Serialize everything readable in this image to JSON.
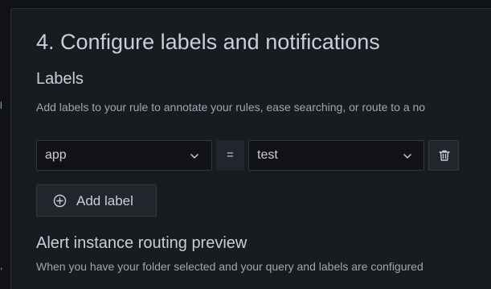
{
  "left_strip": {
    "fragments": [
      "l",
      ","
    ]
  },
  "section": {
    "title": "4. Configure labels and notifications"
  },
  "labels": {
    "heading": "Labels",
    "description": "Add labels to your rule to annotate your rules, ease searching, or route to a no",
    "rows": [
      {
        "key": "app",
        "operator": "=",
        "value": "test"
      }
    ],
    "add_button": "Add label"
  },
  "routing": {
    "heading": "Alert instance routing preview",
    "description": "When you have your folder selected and your query and labels are configured"
  },
  "icons": {
    "key_dropdown": "chevron-down-icon",
    "value_dropdown": "chevron-down-icon",
    "delete": "trash-icon",
    "add": "plus-circle-icon"
  },
  "colors": {
    "background": "#111217",
    "panel": "#181b1f",
    "input_background": "#111217",
    "button_background": "#22252b",
    "border": "#34373d",
    "text_primary": "#ccccdc",
    "text_secondary": "#9fa7b3"
  }
}
